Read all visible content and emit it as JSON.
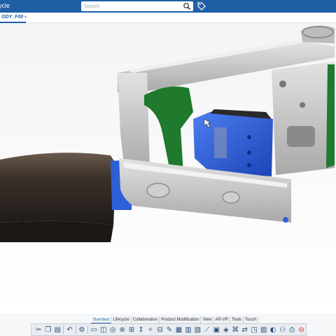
{
  "app": {
    "title": "ycle"
  },
  "search": {
    "placeholder": "Search"
  },
  "tabs": {
    "document": "ODY_F00",
    "add": "+"
  },
  "ribbon": {
    "tabs": [
      "Standard",
      "Lifecycle",
      "Collaboration",
      "Product Modification",
      "View",
      "AR-VR",
      "Tools",
      "Touch"
    ],
    "active": "Standard"
  },
  "toolbar": {
    "icons": [
      "cut-icon",
      "copy-icon",
      "paste-icon",
      "undo-icon",
      "settings-icon",
      "new-doc-icon",
      "sketch-icon",
      "align-icon",
      "cut-section-icon",
      "measure-icon",
      "axis-icon",
      "compass-icon",
      "ruler-icon",
      "edit-icon",
      "grid-icon",
      "table-icon",
      "pattern-icon",
      "line-icon",
      "frame-icon",
      "render-icon",
      "graph-icon",
      "share-icon",
      "select-icon",
      "layout-icon",
      "view-icon",
      "share-network-icon",
      "print-icon",
      "stop-icon"
    ]
  },
  "colors": {
    "brand": "#1f5fa6",
    "part_blue": "#2d5fd6",
    "part_green": "#1f7a2e",
    "frame_gray": "#c9c9c9",
    "dark_body": "#3a302a"
  }
}
